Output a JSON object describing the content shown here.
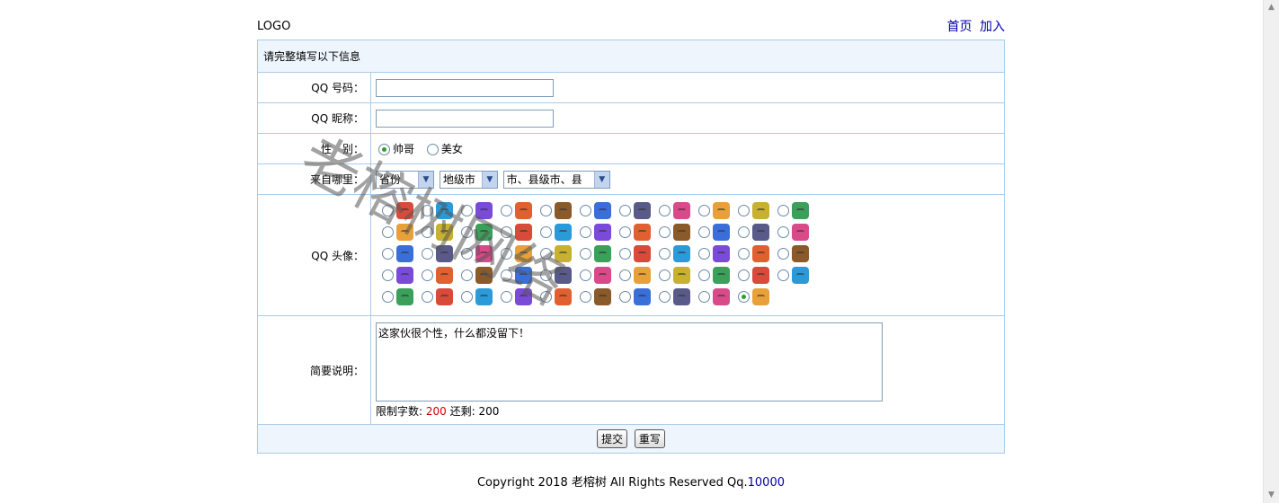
{
  "header": {
    "logo": "LOGO",
    "nav": [
      "首页",
      "加入"
    ]
  },
  "form": {
    "intro": "请完整填写以下信息",
    "qq_number": {
      "label": "QQ 号码：",
      "value": ""
    },
    "nickname": {
      "label": "QQ 昵称：",
      "value": ""
    },
    "gender": {
      "label": "性　别：",
      "options": [
        "帅哥",
        "美女"
      ],
      "selected": "帅哥"
    },
    "region": {
      "label": "来自哪里：",
      "province": "省份",
      "city": "地级市",
      "county": "市、县级市、县"
    },
    "avatar": {
      "label": "QQ 头像：",
      "rows": 5,
      "per_row": 11,
      "last_row_count": 10,
      "selected_index": 53
    },
    "intro_note": {
      "label": "简要说明：",
      "value": "这家伙很个性，什么都没留下！"
    },
    "limit": {
      "label": "限制字数:",
      "max": "200",
      "remain_label": "还剩:",
      "remain": "200"
    },
    "buttons": {
      "submit": "提交",
      "reset": "重写"
    }
  },
  "footer": {
    "copyright": "Copyright 2018 老榕树  All Rights Reserved Qq.",
    "qq": "10000"
  },
  "watermark": "老榕树网络",
  "colors": {
    "border": "#a9cbe8",
    "head_bg": "#eef5fd",
    "link": "#0000aa",
    "red": "#cc0000"
  }
}
